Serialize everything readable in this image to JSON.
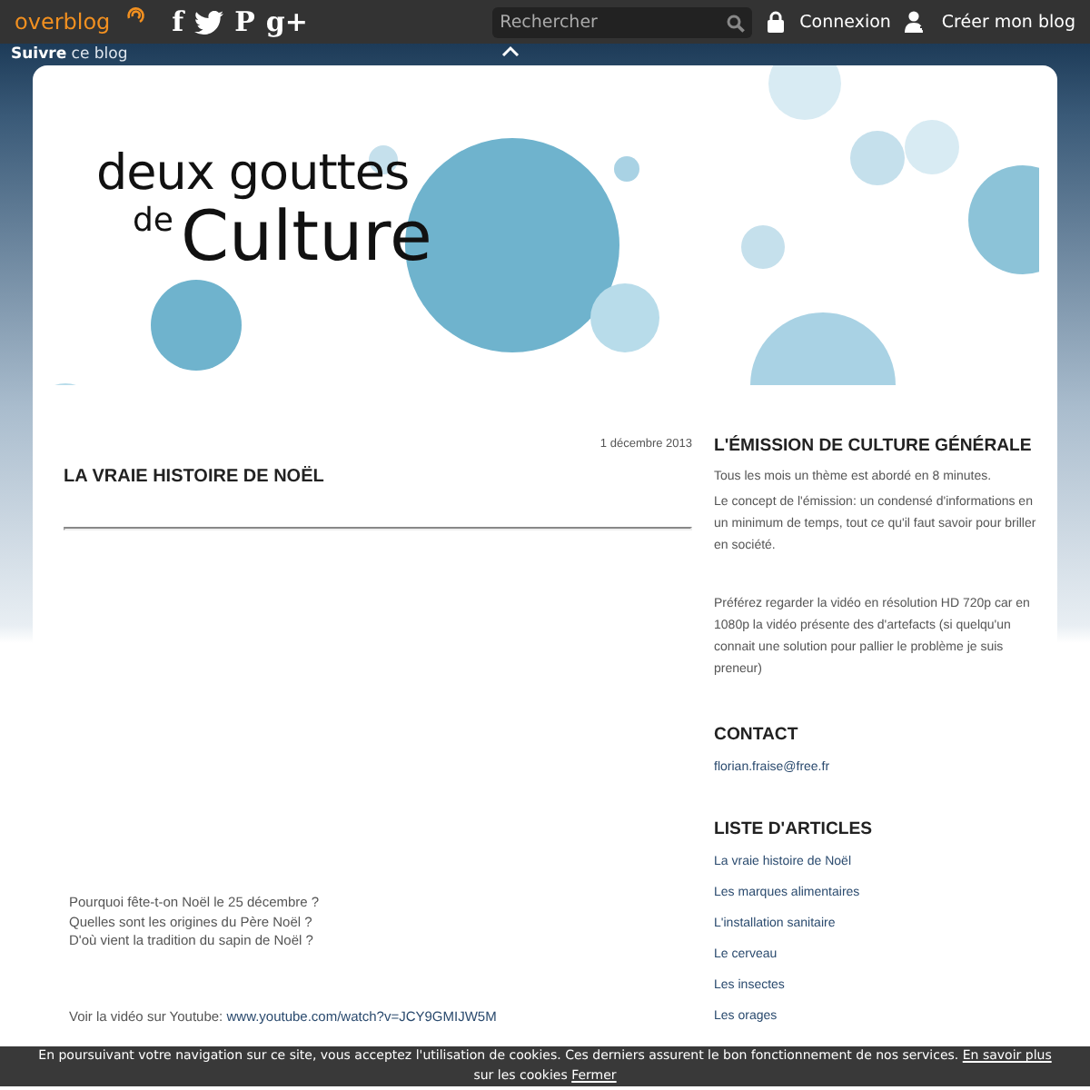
{
  "topbar": {
    "logo": "overblog",
    "social": [
      {
        "kind": "facebook",
        "glyph": "f"
      },
      {
        "kind": "twitter"
      },
      {
        "kind": "pinterest",
        "glyph": "P"
      },
      {
        "kind": "gplus",
        "glyph": "g+"
      }
    ],
    "search": {
      "placeholder": "Rechercher"
    },
    "links": [
      {
        "kind": "lock",
        "label": "Connexion"
      },
      {
        "kind": "user",
        "label": "Créer mon blog"
      }
    ]
  },
  "follow_bar": {
    "label": "**Suivre** ce blog"
  },
  "header": {
    "title_line_1": "deux gouttes",
    "title_line_2": "de",
    "title_line_3": "Culture"
  },
  "post": {
    "date": "1 décembre 2013",
    "title": "LA VRAIE HISTOIRE DE NOËL",
    "questions": [
      "Pourquoi fête-t-on Noël le 25 décembre ?",
      "Quelles sont les origines du Père Noël ?",
      "D'où vient la tradition du sapin de Noël ?"
    ],
    "video_text": "Voir la vidéo sur Youtube: ",
    "video_link": "www.youtube.com/watch?v=JCY9GMIJW5M"
  },
  "sidebar": [
    {
      "kind": "text",
      "title": "L'ÉMISSION DE CULTURE GÉNÉRALE",
      "paragraphs": [
        "Tous les mois un thème est abordé en 8 minutes.",
        "Le concept de l'émission: un condensé d'informations en un minimum de temps, tout ce qu'il faut savoir pour briller en société.",
        "Préférez regarder la vidéo en résolution HD 720p car en 1080p la vidéo présente des d'artefacts (si quelqu'un connait une solution pour pallier le problème je suis preneur)"
      ]
    },
    {
      "kind": "links",
      "title": "CONTACT",
      "links": [
        "florian.fraise@free.fr"
      ]
    },
    {
      "kind": "links",
      "title": "LISTE D'ARTICLES",
      "links": [
        "La vraie histoire de Noël",
        "Les marques alimentaires",
        "L'installation sanitaire",
        "Le cerveau",
        "Les insectes",
        "Les orages"
      ]
    }
  ],
  "cookie_bar": {
    "text": "En poursuivant votre navigation sur ce site, vous acceptez l'utilisation de cookies. Ces derniers assurent le bon fonctionnement de nos services. ",
    "more_link": "En savoir plus",
    "text_after": " sur les cookies ",
    "close_link": "Fermer"
  }
}
